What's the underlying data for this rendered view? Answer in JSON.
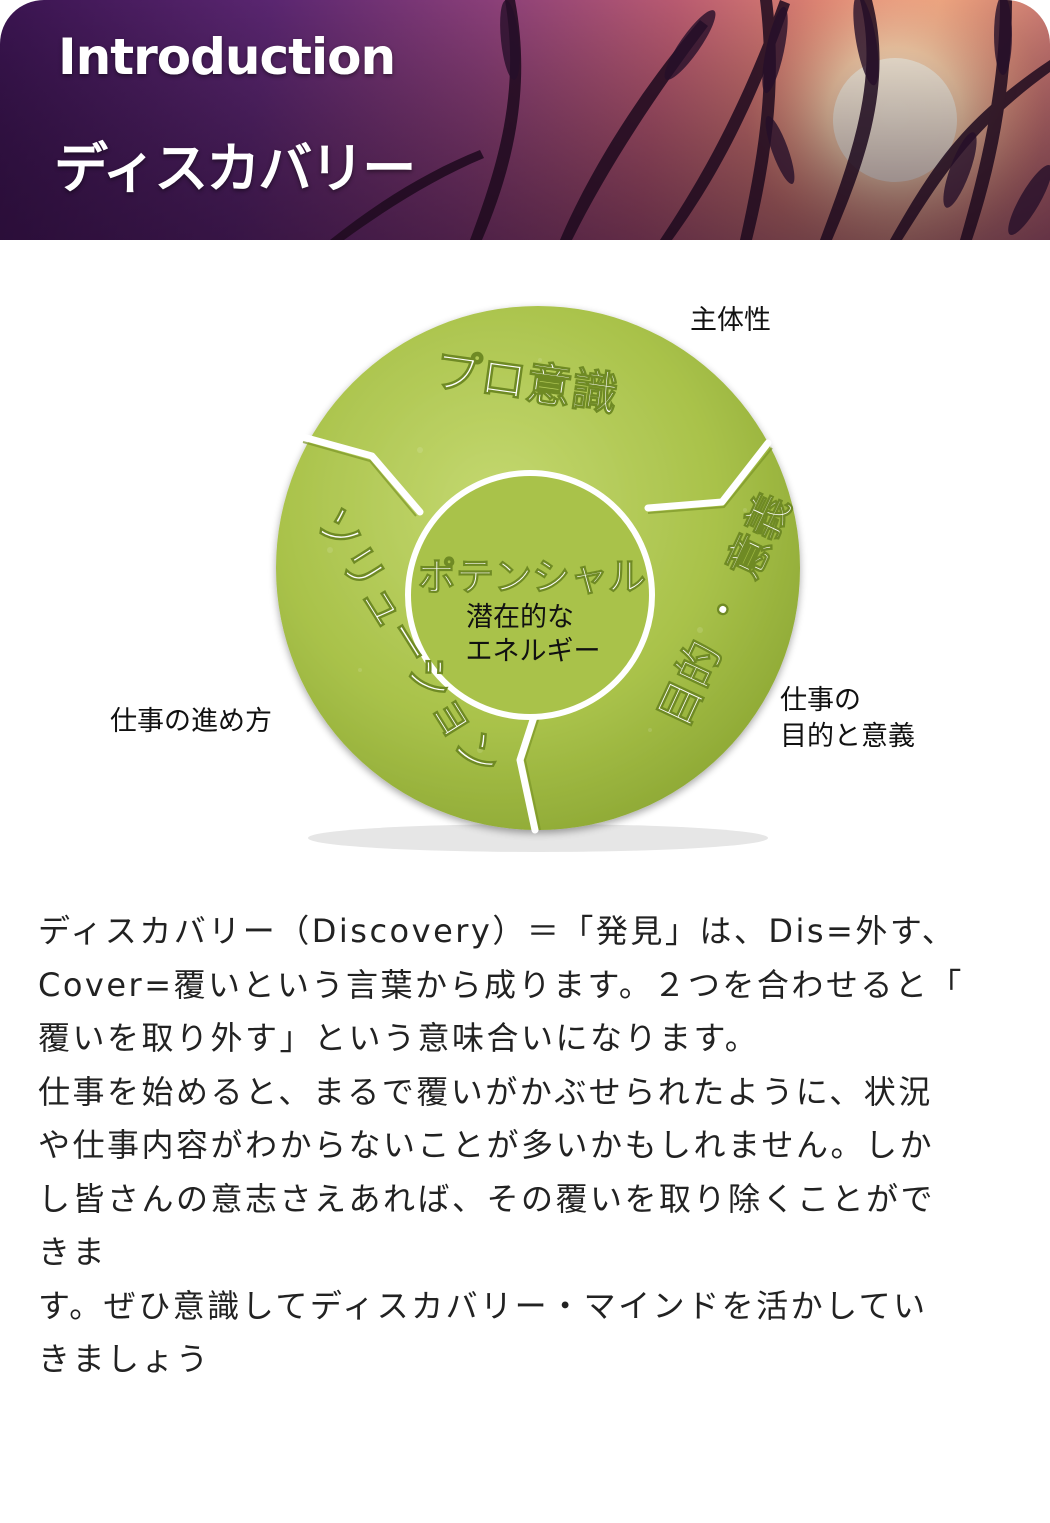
{
  "header": {
    "title": "Introduction",
    "subtitle": "ディスカバリー"
  },
  "diagram": {
    "center_title": "ポテンシャル",
    "center_caption_line1": "潜在的な",
    "center_caption_line2": "エネルギー",
    "segments": [
      {
        "label": "プロ意識",
        "outer_label": "主体性"
      },
      {
        "label_part1": "目的",
        "separator": "・",
        "label_part2": "意義",
        "outer_label_line1": "仕事の",
        "outer_label_line2": "目的と意義"
      },
      {
        "label": "ソリューション",
        "outer_label": "仕事の進め方"
      }
    ],
    "colors": {
      "disk": "#a9c24a",
      "disk_light": "#c4d870",
      "disk_dark": "#8aa532",
      "divider": "#ffffff"
    }
  },
  "body": {
    "paragraphs": [
      "ディスカバリー（Discovery）＝「発見」は、Dis=外す、\nCover=覆いという言葉から成ります。２つを合わせると「\n覆いを取り外す」という意味合いになります。",
      "仕事を始めると、まるで覆いがかぶせられたように、状況\nや仕事内容がわからないことが多いかもしれません。しか\nし皆さんの意志さえあれば、その覆いを取り除くことがで\nきま\nす。ぜひ意識してディスカバリー・マインドを活かしてい\nきましょう"
    ]
  }
}
